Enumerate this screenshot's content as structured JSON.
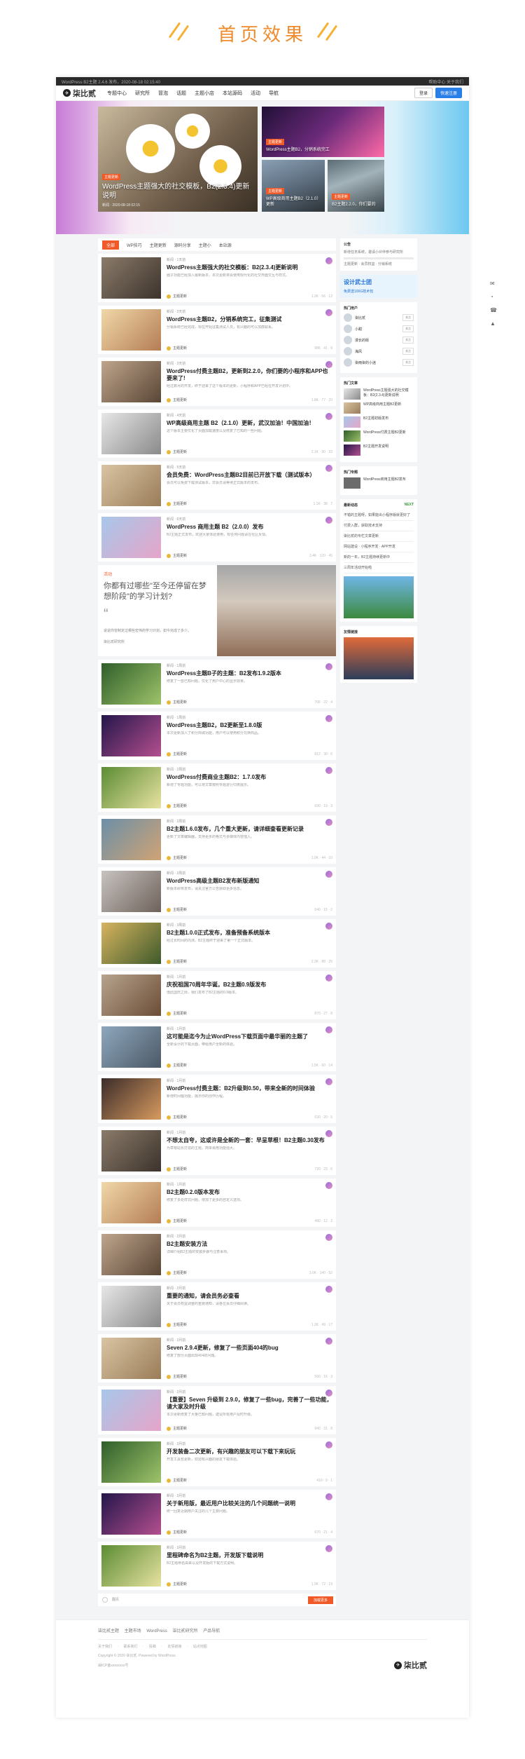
{
  "page_heading": "首页效果",
  "topbar": {
    "left": "WordPress B2主题 2.4.6 发布，2020-08-18 02:15:40",
    "right": "帮助中心  关于我们"
  },
  "nav": {
    "logo": "柒比贰",
    "menu": [
      "专题中心",
      "研究所",
      "冒泡",
      "话题",
      "主题小店",
      "本站源码",
      "活动",
      "导航"
    ],
    "login": "登录",
    "register": "快速注册"
  },
  "hero": {
    "main": {
      "tag": "主题更新",
      "title": "WordPress主题强大的社交模板，B2(2.3.4)更新说明",
      "meta": "新闻 · 2020-08-18 02:15"
    },
    "s1": {
      "tag": "主题更新",
      "title": "WordPress主题B2，分销系统完工"
    },
    "s2": {
      "tag": "主题更新",
      "title": "WP高级商用主题B2（2.1.0）更新"
    },
    "s3": {
      "tag": "主题更新",
      "title": "B2主题2.2.0，你们要的"
    }
  },
  "tabs": [
    "全部",
    "WP技巧",
    "主题更新",
    "源码分享",
    "主题小",
    "本站源"
  ],
  "posts": [
    {
      "meta": "新闻 · 1天前",
      "title": "WordPress主题强大的社交模板：B2(2.3.4)更新说明",
      "excerpt": "圈子功能已经加入最新版本，本次更新将会使用现代化的社交界面交互与样式。",
      "author": "主题更新",
      "stats": "1.2K · 56 · 12"
    },
    {
      "meta": "新闻 · 2天前",
      "title": "WordPress主题B2，分销系统完工，征集测试",
      "excerpt": "分销系统已经完成，现在开始征集测试人员，有兴趣的可以加群联系。",
      "author": "主题更新",
      "stats": "986 · 41 · 9"
    },
    {
      "meta": "新闻 · 3天前",
      "title": "WordPress付费主题B2，更新到2.2.0，你们要的小程序和APP也要来了!",
      "excerpt": "经过数月的开发，终于迎来了这个版本的更新，小程序和APP已经在开发计划中。",
      "author": "主题更新",
      "stats": "1.8K · 77 · 20"
    },
    {
      "meta": "新闻 · 4天前",
      "title": "WP高级商用主题 B2（2.1.0）更新，武汉加油！中国加油！",
      "excerpt": "这个版本主要优化了页面加载速度以及修复了已知的一些问题。",
      "author": "主题更新",
      "stats": "2.1K · 90 · 33"
    },
    {
      "meta": "新闻 · 5天前",
      "title": "会员免费：WordPress主题B2目前已开放下载（测试版本）",
      "excerpt": "会员可以免费下载测试版本，非会员请等待正式版本的发布。",
      "author": "主题更新",
      "stats": "1.1K · 38 · 7"
    },
    {
      "meta": "新闻 · 6天前",
      "title": "WordPress 商用主题 B2（2.0.0）发布",
      "excerpt": "B2主题正式发布，欢迎大家体验使用，有任何问题请在社区反馈。",
      "author": "主题更新",
      "stats": "3.4K · 120 · 45"
    }
  ],
  "promo": {
    "label": "活动",
    "title": "你都有过哪些\"至今还停留在梦想阶段\"的学习计划?",
    "sub": "说说你曾制定过哪些宏伟的学习计划，如今完成了多少。",
    "author": "柒比贰研究所"
  },
  "posts2": [
    {
      "meta": "新闻 · 1周前",
      "title": "WordPress主题B子的主题：B2发布1.9.2版本",
      "excerpt": "修复了一些已知问题，优化了用户中心的显示效果。",
      "author": "主题更新",
      "stats": "765 · 22 · 4"
    },
    {
      "meta": "新闻 · 1周前",
      "title": "WordPress主题B2，B2更新至1.8.0版",
      "excerpt": "本次更新加入了积分商城功能，用户可以使用积分兑换商品。",
      "author": "主题更新",
      "stats": "812 · 30 · 6"
    },
    {
      "meta": "新闻 · 2周前",
      "title": "WordPress付费商业主题B2：1.7.0发布",
      "excerpt": "新增了专题功能，可以将文章按照专题进行归类展示。",
      "author": "主题更新",
      "stats": "690 · 19 · 3"
    },
    {
      "meta": "新闻 · 2周前",
      "title": "B2主题1.6.0发布，几个重大更新，请详细查看更新记录",
      "excerpt": "更新了文章编辑器，支持更多的格式与多媒体内容插入。",
      "author": "主题更新",
      "stats": "1.0K · 44 · 10"
    },
    {
      "meta": "新闻 · 3周前",
      "title": "WordPress高级主题B2发布新版通知",
      "excerpt": "新版本即将发布，请关注官方公告获取更多信息。",
      "author": "主题更新",
      "stats": "540 · 15 · 2"
    },
    {
      "meta": "新闻 · 3周前",
      "title": "B2主题1.0.0正式发布，准备预备系统版本",
      "excerpt": "经过长时间的内测，B2主题终于迎来了第一个正式版本。",
      "author": "主题更新",
      "stats": "2.2K · 88 · 25"
    },
    {
      "meta": "新闻 · 1月前",
      "title": "庆祝祖国70周年华诞，B2主题0.9版发布",
      "excerpt": "值此国庆之际，我们发布了B2主题的0.9版本。",
      "author": "主题更新",
      "stats": "870 · 27 · 8"
    },
    {
      "meta": "新闻 · 1月前",
      "title": "这可能是迄今为止WordPress下载页面中最华丽的主题了",
      "excerpt": "全新设计的下载页面，带给用户全新的体验。",
      "author": "主题更新",
      "stats": "1.5K · 60 · 14"
    },
    {
      "meta": "新闻 · 1月前",
      "title": "WordPress付费主题：B2升级到0.50，带来全新的时间体验",
      "excerpt": "新增时间轴功能，展示你的创作历程。",
      "author": "主题更新",
      "stats": "630 · 20 · 5"
    },
    {
      "meta": "新闻 · 1月前",
      "title": "不想太自夸，这或许是全新的一套：早呈草根！B2主题0.30发布",
      "excerpt": "为草根站长打造的主题，简单易用功能强大。",
      "author": "主题更新",
      "stats": "720 · 23 · 6"
    },
    {
      "meta": "新闻 · 1月前",
      "title": "B2主题0.2.0版本发布",
      "excerpt": "修复了多处样式问题，增加了更多的自定义选项。",
      "author": "主题更新",
      "stats": "480 · 12 · 2"
    },
    {
      "meta": "新闻 · 2月前",
      "title": "B2主题安装方法",
      "excerpt": "详细介绍B2主题的安装步骤与注意事项。",
      "author": "主题更新",
      "stats": "3.0K · 140 · 52"
    },
    {
      "meta": "新闻 · 2月前",
      "title": "重要的通知，请会员务必查看",
      "excerpt": "关于会员权益调整的重要通知，请各位会员仔细阅读。",
      "author": "主题更新",
      "stats": "1.3K · 49 · 17"
    },
    {
      "meta": "新闻 · 2月前",
      "title": "Seven 2.9.4更新，修复了一些页面404的bug",
      "excerpt": "修复了部分页面出现404的问题。",
      "author": "主题更新",
      "stats": "560 · 16 · 3"
    },
    {
      "meta": "新闻 · 2月前",
      "title": "【重要】Seven 升级到 2.9.0，修复了一些bug，完善了一些功能，请大家及时升级",
      "excerpt": "本次更新修复了大量已知问题，建议所有用户及时升级。",
      "author": "主题更新",
      "stats": "940 · 31 · 8"
    },
    {
      "meta": "新闻 · 3月前",
      "title": "开发装备二次更新，有兴趣的朋友可以下载下来玩玩",
      "excerpt": "开发工具包更新，欢迎有兴趣的朋友下载体验。",
      "author": "主题更新",
      "stats": "410 · 9 · 1"
    },
    {
      "meta": "新闻 · 3月前",
      "title": "关于新用版，最近用户比较关注的几个问题统一说明",
      "excerpt": "统一回复近期用户关注的几个主要问题。",
      "author": "主题更新",
      "stats": "670 · 21 · 4"
    },
    {
      "meta": "新闻 · 3月前",
      "title": "里程碑命名为B2主题，开发版下载说明",
      "excerpt": "B2主题命名由来以及开发版的下载方式说明。",
      "author": "主题更新",
      "stats": "1.9K · 72 · 19"
    }
  ],
  "pager": {
    "link": "翻页",
    "more": "加载更多"
  },
  "sidebar": {
    "notice": {
      "h": "公告",
      "text": "新增任务系统，邀请小伙伴参与研究所",
      "sub": "主题更新 · 会员权益 · 分销系统"
    },
    "ad": {
      "title": "设计武士团",
      "sub": "免费送100G技术包"
    },
    "users": {
      "h": "热门用户",
      "items": [
        "柒比贰",
        "小甜",
        "漫长的街",
        "海风",
        "柒雨柒的小迷"
      ],
      "follow": "关注"
    },
    "hot": {
      "h": "热门文章",
      "items": [
        "WordPress主题强大的社交模板：B2(2.3.4)更新说明",
        "WP高级商用主题B2更新",
        "B2主题初版发布",
        "WordPress付费主题B2更新",
        "B2主题开发说明"
      ]
    },
    "focus": {
      "h": "热门专题",
      "title": "WordPress商用主题B2发布"
    },
    "feed": {
      "h": "最新动态",
      "next": "NEXT",
      "items": [
        "不错的主题呀，如果能出小程序版就更好了",
        "付费入群，获取技术支持",
        "柒比贰的专栏文章更新",
        "网站建设 · 小程序开发 · APP开发",
        "新的一年，B2主题持续更新中",
        "三周年活动开始啦"
      ]
    },
    "links": {
      "h": "友情链接"
    }
  },
  "footer": {
    "links": "柒比贰主题 主题市场 WordPress 柒比贰研究所 产品导航",
    "links2": "关于我们 · 联系我们 · 投稿 · 友情链接 · 站点地图",
    "cp1": "Copyright © 2020 柒比贰. Powered by WordPress.",
    "cp2": "闽ICP备xxxxxxxx号",
    "logo": "柒比贰"
  }
}
